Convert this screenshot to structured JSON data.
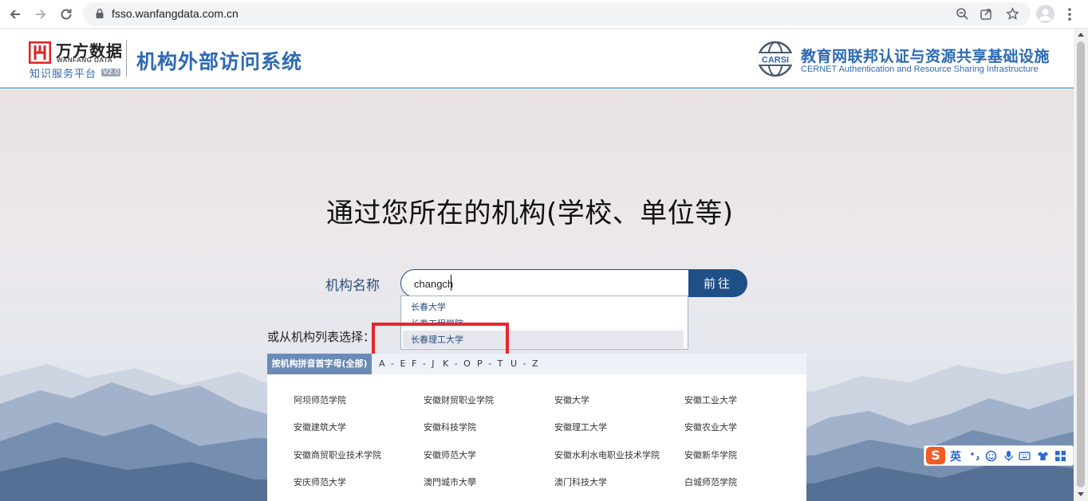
{
  "browser": {
    "url": "fsso.wanfangdata.com.cn"
  },
  "header": {
    "logo_cn": "万方数据",
    "logo_en": "WANFANG DATA",
    "logo_sub": "知识服务平台",
    "logo_version": "V2.0",
    "system_title": "机构外部访问系统",
    "carsi_mark": "CARSI",
    "carsi_cn": "教育网联邦认证与资源共享基础设施",
    "carsi_en": "CERNET Authentication and Resource Sharing Infrastructure"
  },
  "main": {
    "headline": "通过您所在的机构(学校、单位等)",
    "institution_label": "机构名称",
    "search_value": "changch",
    "go_label": "前往",
    "or_select_label": "或从机构列表选择：",
    "suggestions": [
      "长春大学",
      "长春工程学院",
      "长春理工大学"
    ]
  },
  "list": {
    "tabs": [
      "按机构拼音首字母(全部)",
      "A - E",
      "F - J",
      "K - O",
      "P - T",
      "U - Z"
    ],
    "institutions": [
      "阿坝师范学院",
      "安徽财贸职业学院",
      "安徽大学",
      "安徽工业大学",
      "安徽建筑大学",
      "安徽科技学院",
      "安徽理工大学",
      "安徽农业大学",
      "安徽商贸职业技术学院",
      "安徽师范大学",
      "安徽水利水电职业技术学院",
      "安徽新华学院",
      "安庆师范大学",
      "澳門城市大學",
      "澳门科技大学",
      "白城师范学院"
    ]
  },
  "ime": {
    "logo": "S",
    "lang": "英"
  },
  "colors": {
    "accent": "#2e6ab3",
    "button": "#1f4f87",
    "highlight": "#e8262b",
    "active_tab": "#6a8bb5"
  }
}
